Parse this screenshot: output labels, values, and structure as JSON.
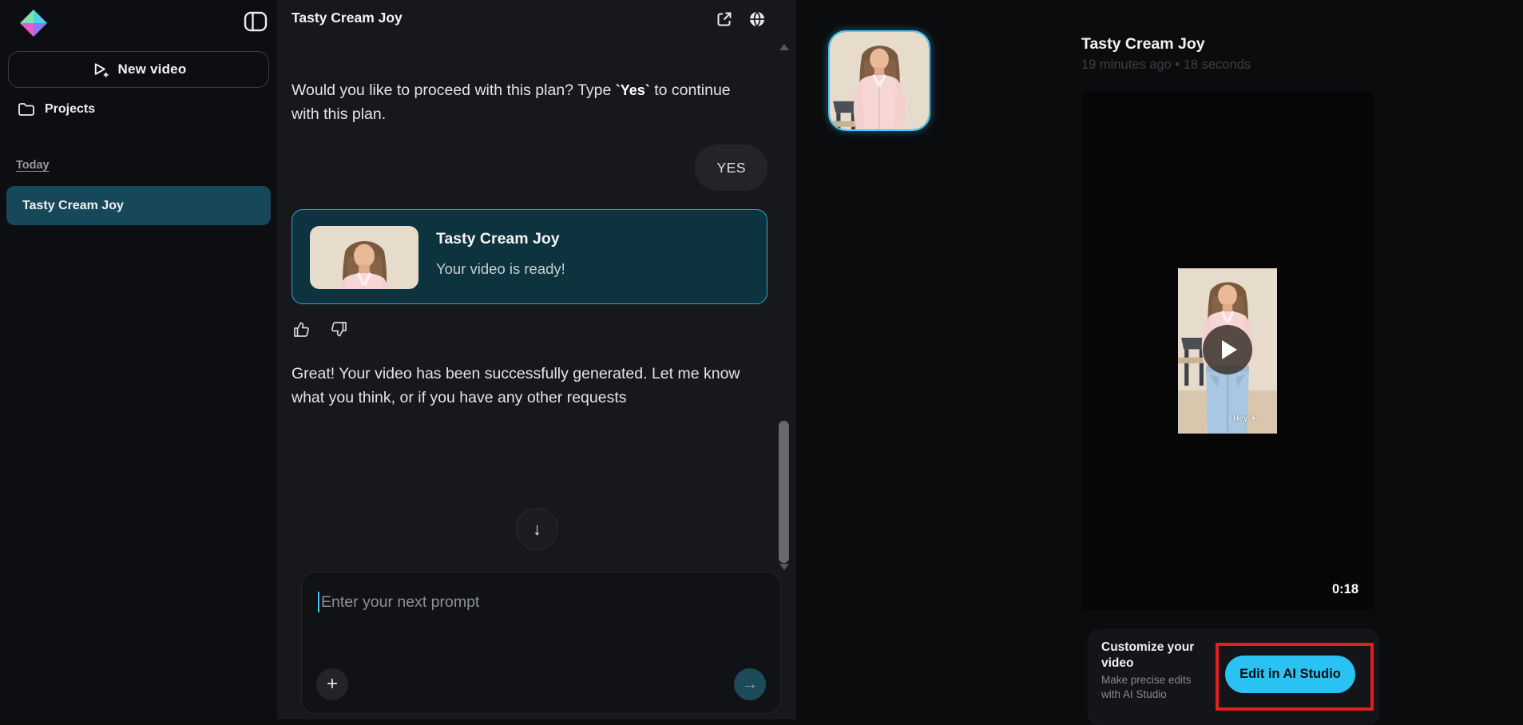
{
  "colors": {
    "accent_cyan": "#29c2f2",
    "selected_item_teal": "#16485a",
    "card_border_cyan": "#2ba9cc",
    "annotation_red": "#e2201b"
  },
  "sidebar": {
    "new_video": "New video",
    "projects": "Projects",
    "section": "Today",
    "items": [
      {
        "label": "Tasty Cream Joy"
      }
    ]
  },
  "chat": {
    "title": "Tasty Cream Joy",
    "message1": {
      "before": "Would you like to proceed with this plan? Type ",
      "code": "`Yes`",
      "after": " to continue with this plan."
    },
    "user_reply": "YES",
    "video_card": {
      "title": "Tasty Cream Joy",
      "subtitle": "Your video is ready!"
    },
    "message2": "Great! Your video has been successfully generated. Let me know what you think, or if you have any other requests",
    "composer": {
      "placeholder": "Enter your next prompt"
    },
    "scroll_down_glyph": "↓",
    "plus_glyph": "+",
    "send_glyph": "→"
  },
  "preview": {
    "title": "Tasty Cream Joy",
    "meta": "19 minutes ago • 18 seconds",
    "duration": "0:18",
    "watermark": "Hey ✦",
    "customize": {
      "title": "Customize your video",
      "subtitle": "Make precise edits with AI Studio",
      "button": "Edit in AI Studio"
    }
  }
}
